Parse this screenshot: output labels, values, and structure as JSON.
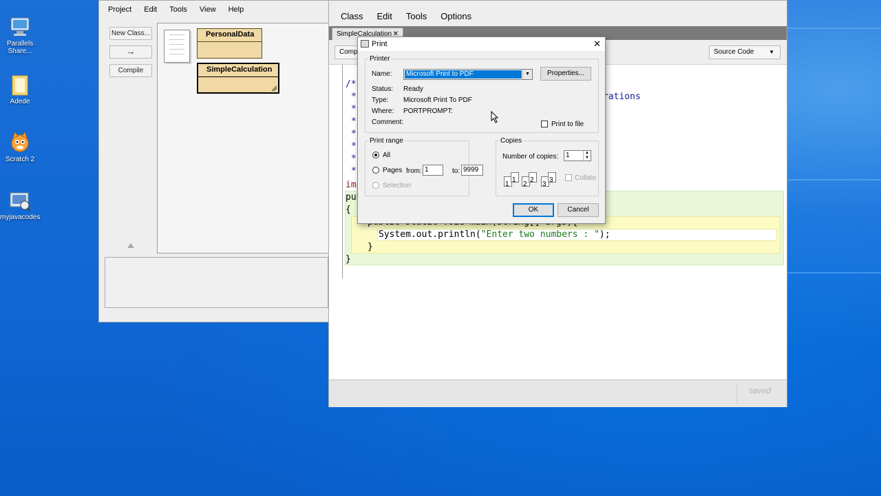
{
  "desktop": {
    "icons": [
      {
        "label": "Parallels Share...",
        "name": "parallels-shared-icon"
      },
      {
        "label": "Adede",
        "name": "folder-icon"
      },
      {
        "label": "Scratch 2",
        "name": "scratch-cat-icon"
      },
      {
        "label": "myjavacodes",
        "name": "java-folder-icon"
      }
    ]
  },
  "bluej": {
    "menu": [
      "Project",
      "Edit",
      "Tools",
      "View",
      "Help"
    ],
    "buttons": {
      "new_class": "New Class...",
      "arrow": "→",
      "compile": "Compile"
    },
    "classes": [
      "PersonalData",
      "SimpleCalculation"
    ]
  },
  "editor": {
    "menu": [
      "Class",
      "Edit",
      "Tools",
      "Options"
    ],
    "tab": "SimpleCalculation",
    "tab_close": "✕",
    "compile_button": "Comp",
    "view_select": "Source Code",
    "status": "saved",
    "code": {
      "line_comment_start": "/*",
      "line_star": "*",
      "line1_tail": "rations",
      "line_imp": "imp",
      "line_pub": "pub",
      "open_brace": "{",
      "method_sig": "public static void main(String[] args){",
      "println": "System.out.println(",
      "string": "\"Enter two numbers : \"",
      "println_end": ");",
      "close_method": "}",
      "close_class": "}"
    }
  },
  "print_dialog": {
    "title": "Print",
    "close": "✕",
    "printer_group": "Printer",
    "name_label": "Name:",
    "printer_name": "Microsoft Print to PDF",
    "properties_button": "Properties...",
    "status_label": "Status:",
    "status_value": "Ready",
    "type_label": "Type:",
    "type_value": "Microsoft Print To PDF",
    "where_label": "Where:",
    "where_value": "PORTPROMPT:",
    "comment_label": "Comment:",
    "print_to_file": "Print to file",
    "range_group": "Print range",
    "range_all": "All",
    "range_pages": "Pages",
    "from_label": "from:",
    "from_value": "1",
    "to_label": "to:",
    "to_value": "9999",
    "range_selection": "Selection",
    "copies_group": "Copies",
    "copies_label": "Number of copies:",
    "copies_value": "1",
    "collate": "Collate",
    "copy_icons": [
      "1",
      "1",
      "2",
      "2",
      "3",
      "3"
    ],
    "ok": "OK",
    "cancel": "Cancel"
  }
}
